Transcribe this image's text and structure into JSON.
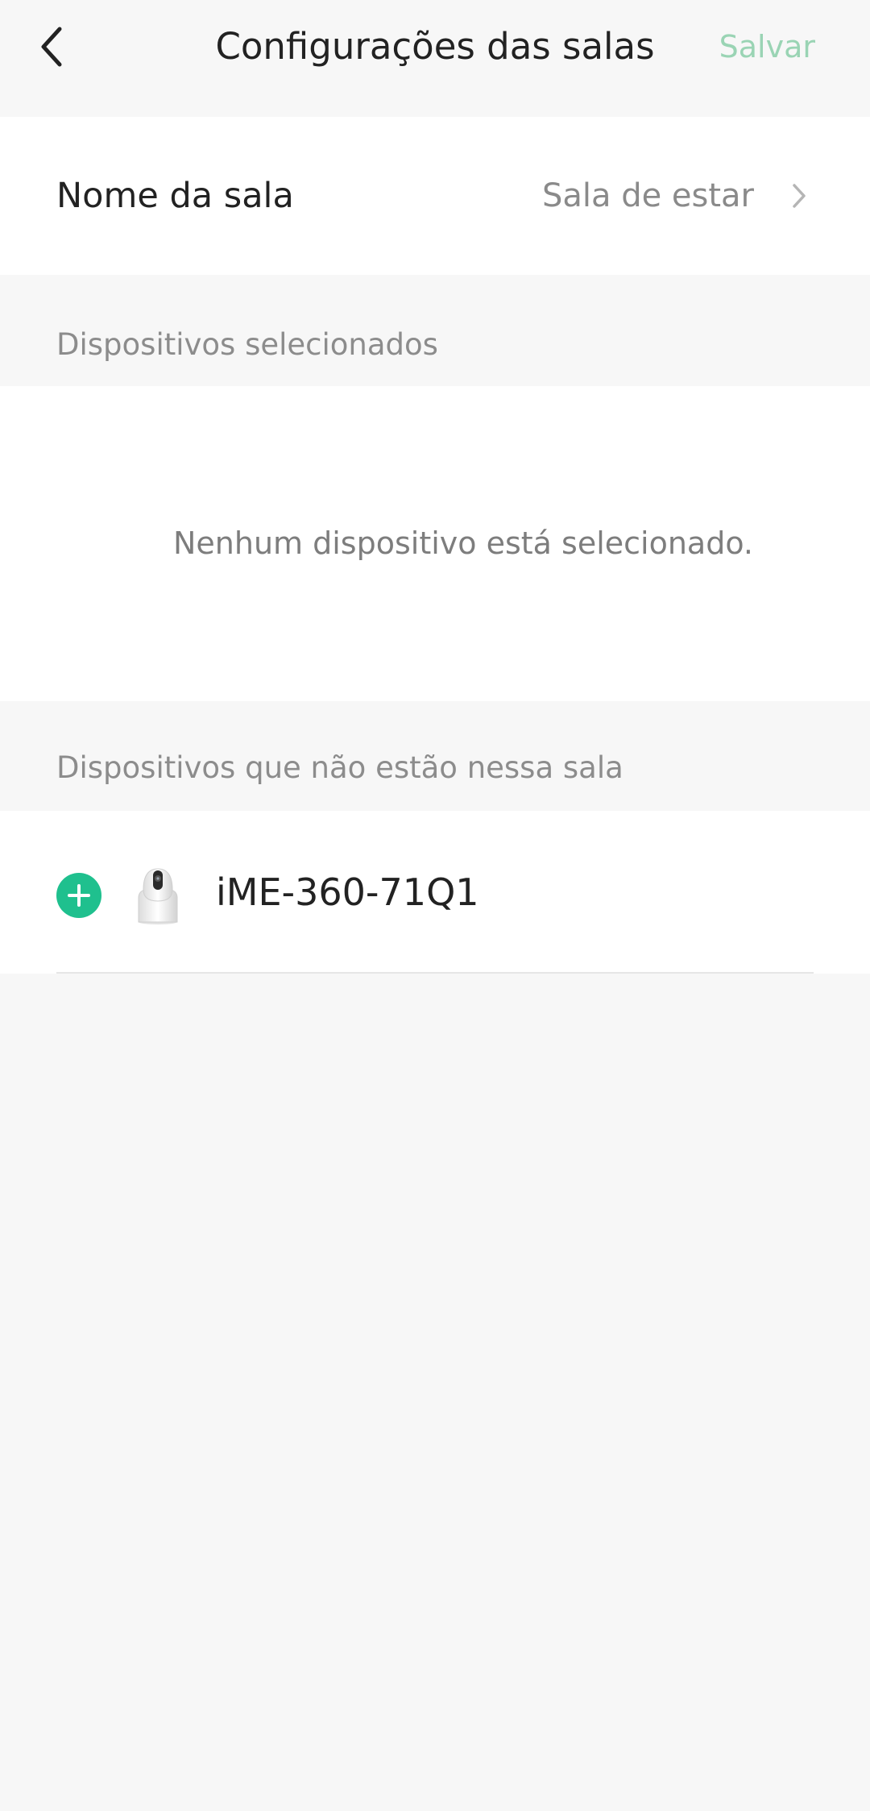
{
  "header": {
    "title": "Configurações das salas",
    "save_label": "Salvar",
    "back_icon": "chevron-left-icon"
  },
  "room_name": {
    "label": "Nome da sala",
    "value": "Sala de estar",
    "chevron_icon": "chevron-right-icon"
  },
  "selected_devices": {
    "heading": "Dispositivos selecionados",
    "empty_message": "Nenhum dispositivo está selecionado."
  },
  "other_devices": {
    "heading": "Dispositivos que não estão nessa sala",
    "items": [
      {
        "name": "iME-360-71Q1",
        "add_icon": "plus-circle-icon",
        "device_icon": "camera-icon"
      }
    ]
  },
  "colors": {
    "accent": "#1fc08e",
    "save_text": "#9ad4b4",
    "background": "#f7f7f7",
    "card": "#ffffff"
  }
}
